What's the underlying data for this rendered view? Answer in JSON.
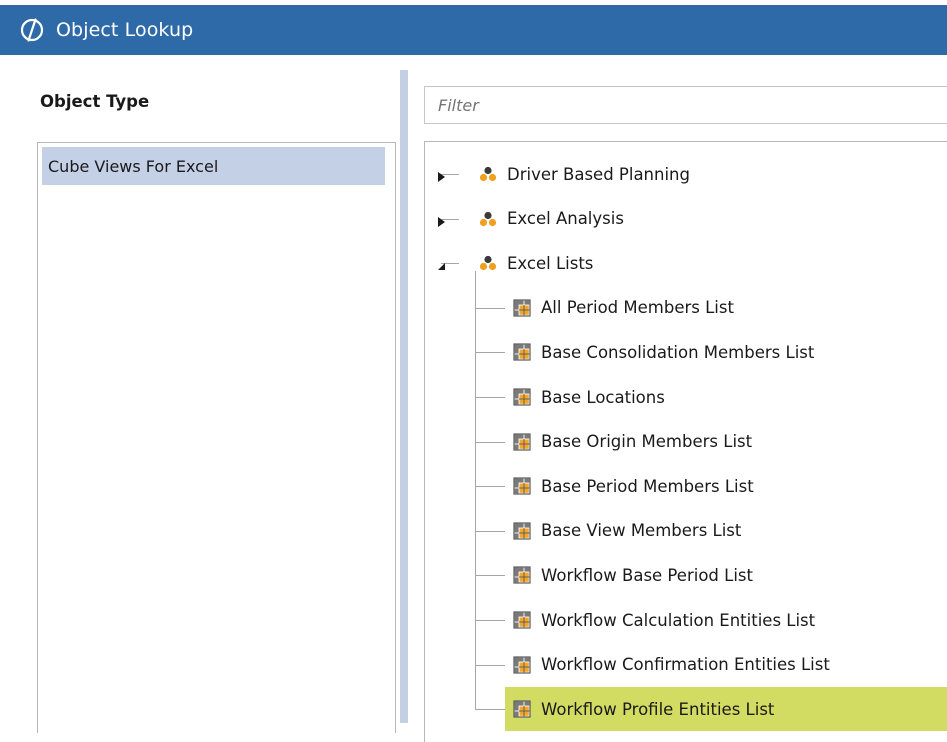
{
  "window": {
    "title": "Object Lookup",
    "logo_icon": "onestream-logo-icon"
  },
  "left_panel": {
    "header": "Object Type",
    "items": [
      {
        "label": "Cube Views For Excel",
        "selected": true
      }
    ]
  },
  "right_panel": {
    "filter": {
      "placeholder": "Filter",
      "value": ""
    },
    "tree": [
      {
        "label": "Driver Based Planning",
        "icon": "group-icon",
        "expanded": false
      },
      {
        "label": "Excel Analysis",
        "icon": "group-icon",
        "expanded": false
      },
      {
        "label": "Excel Lists",
        "icon": "group-icon",
        "expanded": true,
        "children": [
          {
            "label": "All Period Members List",
            "icon": "cube-view-icon"
          },
          {
            "label": "Base Consolidation Members List",
            "icon": "cube-view-icon"
          },
          {
            "label": "Base Locations",
            "icon": "cube-view-icon"
          },
          {
            "label": "Base Origin Members List",
            "icon": "cube-view-icon"
          },
          {
            "label": "Base Period Members List",
            "icon": "cube-view-icon"
          },
          {
            "label": "Base View Members List",
            "icon": "cube-view-icon"
          },
          {
            "label": "Workflow Base Period List",
            "icon": "cube-view-icon"
          },
          {
            "label": "Workflow Calculation Entities List",
            "icon": "cube-view-icon"
          },
          {
            "label": "Workflow Confirmation Entities List",
            "icon": "cube-view-icon"
          },
          {
            "label": "Workflow Profile Entities List",
            "icon": "cube-view-icon",
            "selected": true
          }
        ]
      }
    ]
  },
  "colors": {
    "titlebar": "#2f6aa8",
    "selection_list": "#c4d0e6",
    "selection_tree": "#d2dc62",
    "splitter": "#c3d0e3",
    "group_icon": "#f0a020"
  }
}
